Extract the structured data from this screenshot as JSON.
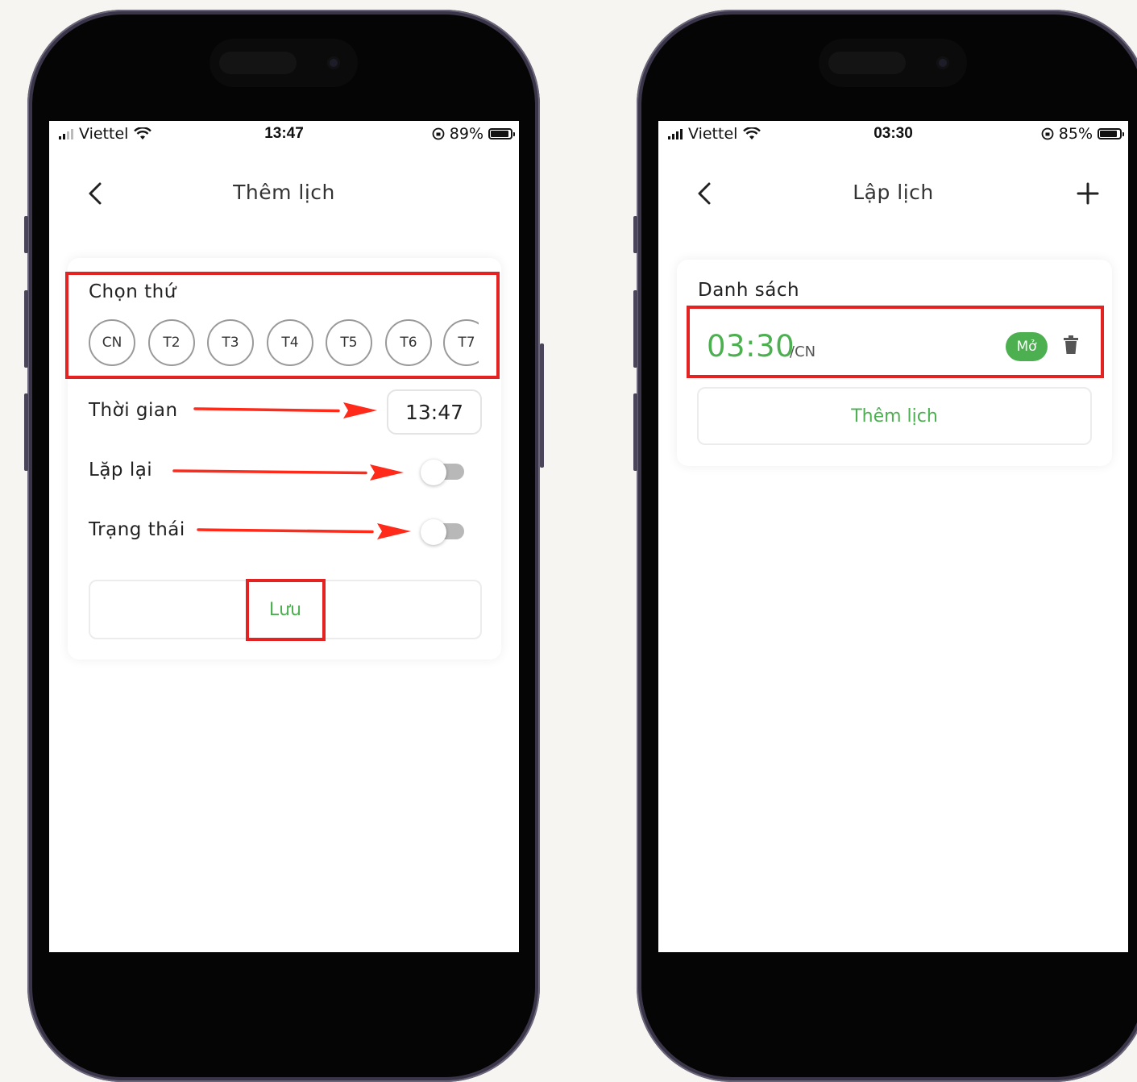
{
  "colors": {
    "accent_green": "#4caf50",
    "highlight_red": "#e52222",
    "arrow_red": "#ff2a1a"
  },
  "left": {
    "status": {
      "carrier": "Viettel",
      "time": "13:47",
      "battery": "89%",
      "battery_level": 0.89
    },
    "header": {
      "title": "Thêm lịch",
      "back_icon": "chevron-left-icon"
    },
    "form": {
      "choose_day_label": "Chọn thứ",
      "days": [
        "CN",
        "T2",
        "T3",
        "T4",
        "T5",
        "T6",
        "T7"
      ],
      "time_label": "Thời gian",
      "time_value": "13:47",
      "repeat_label": "Lặp lại",
      "repeat_on": false,
      "status_label": "Trạng thái",
      "status_on": false,
      "save_label": "Lưu"
    }
  },
  "right": {
    "status": {
      "carrier": "Viettel",
      "time": "03:30",
      "battery": "85%",
      "battery_level": 0.85
    },
    "header": {
      "title": "Lập lịch",
      "back_icon": "chevron-left-icon",
      "add_icon": "plus-icon"
    },
    "list": {
      "title": "Danh sách",
      "items": [
        {
          "time": "03:30",
          "days": "/CN",
          "state": "Mở",
          "delete_icon": "trash-icon"
        }
      ],
      "add_label": "Thêm lịch"
    }
  }
}
